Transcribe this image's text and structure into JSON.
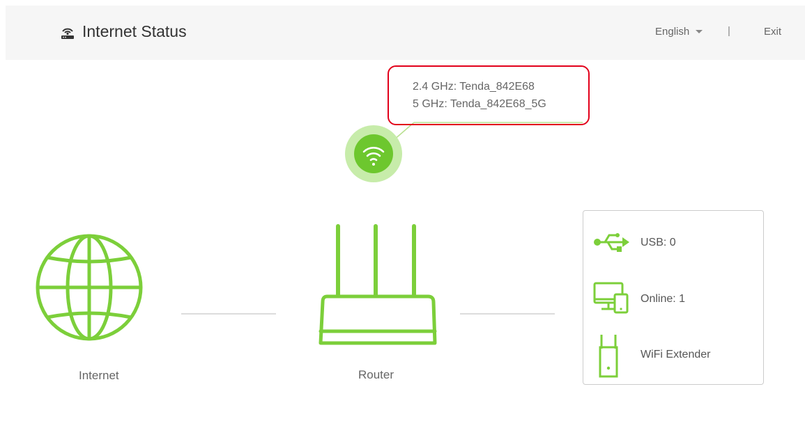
{
  "header": {
    "title": "Internet Status",
    "title_icon": "router-wifi-icon",
    "language": "English",
    "separator": "|",
    "exit": "Exit"
  },
  "wifi": {
    "ssid_24": "2.4 GHz: Tenda_842E68",
    "ssid_5": "5 GHz: Tenda_842E68_5G",
    "icon": "wifi-icon"
  },
  "diagram": {
    "internet_label": "Internet",
    "router_label": "Router",
    "internet_icon": "globe-icon",
    "router_icon": "router-icon"
  },
  "devices": {
    "usb_label": "USB:",
    "usb_count": "0",
    "online_label": "Online:",
    "online_count": "1",
    "extender_label": "WiFi Extender",
    "usb_icon": "usb-icon",
    "online_icon": "devices-icon",
    "extender_icon": "extender-icon"
  },
  "colors": {
    "accent": "#7ccf3a",
    "accent_light": "#c7ecaa",
    "highlight": "#e2001a"
  }
}
